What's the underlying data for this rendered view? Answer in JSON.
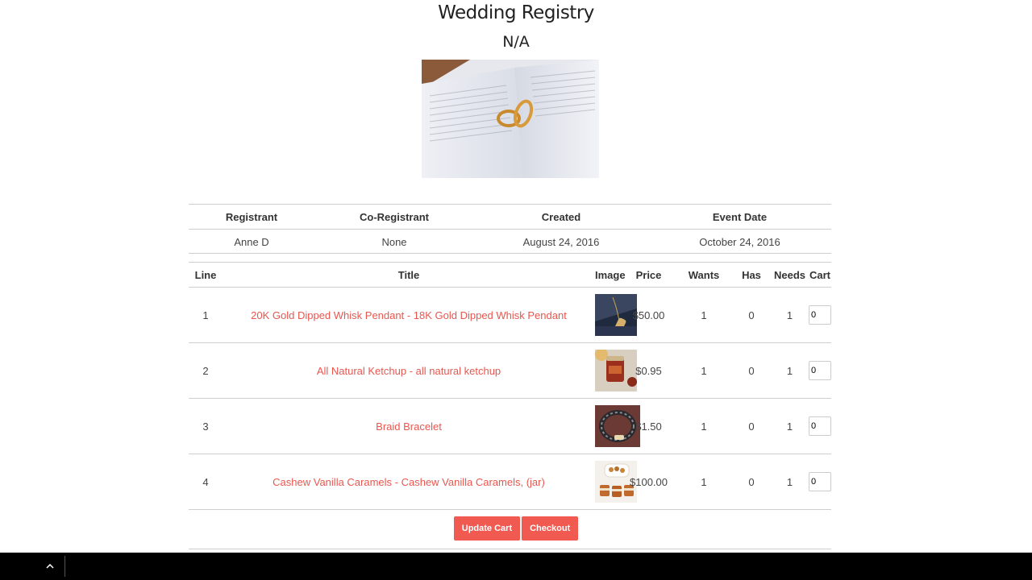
{
  "header": {
    "title": "Wedding Registry",
    "subtitle": "N/A"
  },
  "hero_image": {
    "icon": "wedding-rings-on-book-photo"
  },
  "registry_info": {
    "headers": [
      "Registrant",
      "Co-Registrant",
      "Created",
      "Event Date"
    ],
    "values": [
      "Anne D",
      "None",
      "August 24, 2016",
      "October 24, 2016"
    ]
  },
  "items_table": {
    "headers": {
      "line": "Line",
      "title": "Title",
      "image": "Image",
      "price": "Price",
      "wants": "Wants",
      "has": "Has",
      "needs": "Needs",
      "cart": "Cart"
    },
    "rows": [
      {
        "line": "1",
        "title": "20K Gold Dipped Whisk Pendant - 18K Gold Dipped Whisk Pendant",
        "image": "whisk-pendant-photo",
        "price": "$50.00",
        "wants": "1",
        "has": "0",
        "needs": "1",
        "cart": "0"
      },
      {
        "line": "2",
        "title": "All Natural Ketchup - all natural ketchup",
        "image": "ketchup-jar-photo",
        "price": "$0.95",
        "wants": "1",
        "has": "0",
        "needs": "1",
        "cart": "0"
      },
      {
        "line": "3",
        "title": "Braid Bracelet",
        "image": "braid-bracelet-photo",
        "price": "$1.50",
        "wants": "1",
        "has": "0",
        "needs": "1",
        "cart": "0"
      },
      {
        "line": "4",
        "title": "Cashew Vanilla Caramels - Cashew Vanilla Caramels, (jar)",
        "image": "caramels-photo",
        "price": "$100.00",
        "wants": "1",
        "has": "0",
        "needs": "1",
        "cart": "0"
      }
    ]
  },
  "actions": {
    "update_cart": "Update Cart",
    "checkout": "Checkout"
  },
  "colors": {
    "link": "#e8574f",
    "button": "#f15a51",
    "taskbar": "#000000"
  },
  "taskbar": {
    "icon": "chevron-up-icon"
  }
}
